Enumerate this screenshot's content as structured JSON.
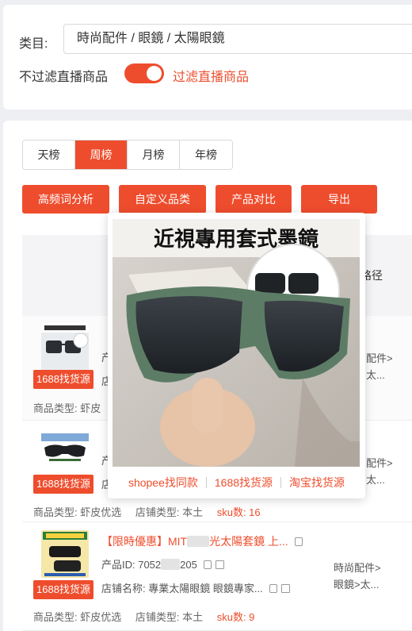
{
  "filters": {
    "category_label": "类目:",
    "category_value": "時尚配件 / 眼鏡 / 太陽眼鏡",
    "live_filter_label": "不过滤直播商品",
    "live_filter_toggle_text": "过滤直播商品",
    "live_filter_on": true
  },
  "tabs": [
    {
      "label": "天榜",
      "active": false
    },
    {
      "label": "周榜",
      "active": true
    },
    {
      "label": "月榜",
      "active": false
    },
    {
      "label": "年榜",
      "active": false
    }
  ],
  "actions": {
    "keyword_analysis": "高频词分析",
    "custom_category": "自定义品类",
    "compare": "产品对比",
    "export": "导出"
  },
  "table": {
    "path_header_fragment": "路径"
  },
  "popup": {
    "image_title": "近視專用套式墨鏡",
    "link_shopee": "shopee找同款",
    "link_1688": "1688找货源",
    "link_taobao": "淘宝找货源"
  },
  "rows": [
    {
      "title_fragment": "【",
      "id_fragment": "产",
      "shop_fragment": "店",
      "path_line1": "配件>",
      "path_line2": "太...",
      "source_badge": "1688找货源",
      "meta_type": "商品类型: 虾皮"
    },
    {
      "id_fragment": "产",
      "shop_fragment": "店",
      "path_line1": "配件>",
      "path_line2": "太...",
      "source_badge": "1688找货源",
      "meta_type": "商品类型: 虾皮优选",
      "meta_shop_type": "店铺类型: 本土",
      "meta_sku": "sku数: 16"
    },
    {
      "title": "【限時優惠】MIT",
      "title_tail": "光太陽套鏡 上...",
      "id_label": "产品ID: 7052",
      "id_tail": "205",
      "shop_label": "店铺名称: 專業太陽眼鏡 眼鏡專家...",
      "path_line1": "時尚配件>",
      "path_line2": "眼鏡>太...",
      "source_badge": "1688找货源",
      "meta_type": "商品类型: 虾皮优选",
      "meta_shop_type": "店铺类型: 本土",
      "meta_sku": "sku数: 9"
    }
  ],
  "colors": {
    "accent": "#ee4d2d"
  }
}
